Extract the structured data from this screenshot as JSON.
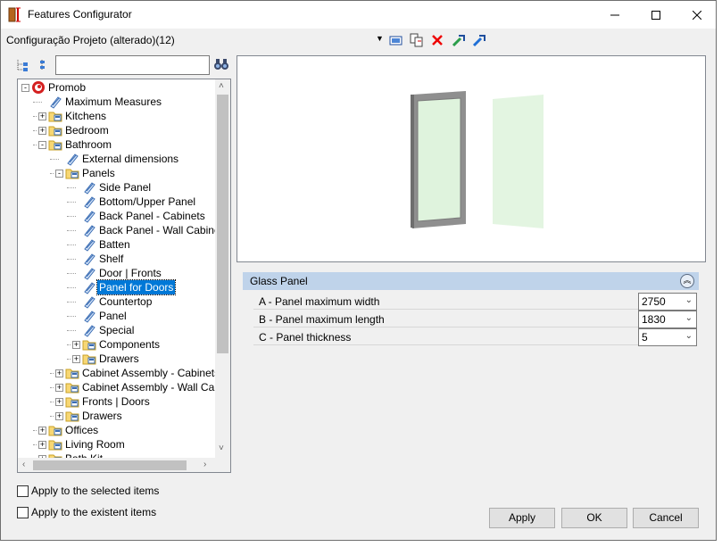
{
  "window": {
    "title": "Features Configurator",
    "icon": "features-configurator-icon"
  },
  "toolbar": {
    "config_name": "Configuração Projeto (alterado)(12)",
    "icons": [
      "dropdown-icon",
      "screen-icon",
      "copy-icon",
      "delete-icon",
      "import-icon",
      "export-icon"
    ]
  },
  "search": {
    "value": "",
    "icons": [
      "expand-tree-icon",
      "collapse-tree-icon",
      "binoculars-icon"
    ]
  },
  "tree": {
    "items": [
      {
        "label": "Promob"
      },
      {
        "label": "Maximum Measures"
      },
      {
        "label": "Kitchens"
      },
      {
        "label": "Bedroom"
      },
      {
        "label": "Bathroom"
      },
      {
        "label": "External dimensions"
      },
      {
        "label": "Panels"
      },
      {
        "label": "Side Panel"
      },
      {
        "label": "Bottom/Upper Panel"
      },
      {
        "label": "Back Panel - Cabinets"
      },
      {
        "label": "Back Panel - Wall Cabinets"
      },
      {
        "label": "Batten"
      },
      {
        "label": "Shelf"
      },
      {
        "label": "Door | Fronts"
      },
      {
        "label": "Panel for Doors"
      },
      {
        "label": "Countertop"
      },
      {
        "label": "Panel"
      },
      {
        "label": "Special"
      },
      {
        "label": "Components"
      },
      {
        "label": "Drawers"
      },
      {
        "label": "Cabinet Assembly - Cabinets"
      },
      {
        "label": "Cabinet Assembly - Wall Cabinets"
      },
      {
        "label": "Fronts | Doors"
      },
      {
        "label": "Drawers"
      },
      {
        "label": "Offices"
      },
      {
        "label": "Living Room"
      },
      {
        "label": "Bath Kit"
      }
    ],
    "selected": "Panel for Doors"
  },
  "properties": {
    "section_title": "Glass Panel",
    "rows": [
      {
        "label": "A - Panel maximum width",
        "value": "2750"
      },
      {
        "label": "B - Panel maximum length",
        "value": "1830"
      },
      {
        "label": "C - Panel thickness",
        "value": "5"
      }
    ]
  },
  "options": {
    "apply_selected": "Apply to the selected items",
    "apply_existent": "Apply to the existent items"
  },
  "buttons": {
    "apply": "Apply",
    "ok": "OK",
    "cancel": "Cancel"
  },
  "colors": {
    "selection": "#0078d7",
    "section_header": "#bfd3ea",
    "glass": "#dff3dd",
    "frame": "#9a9a9a"
  }
}
